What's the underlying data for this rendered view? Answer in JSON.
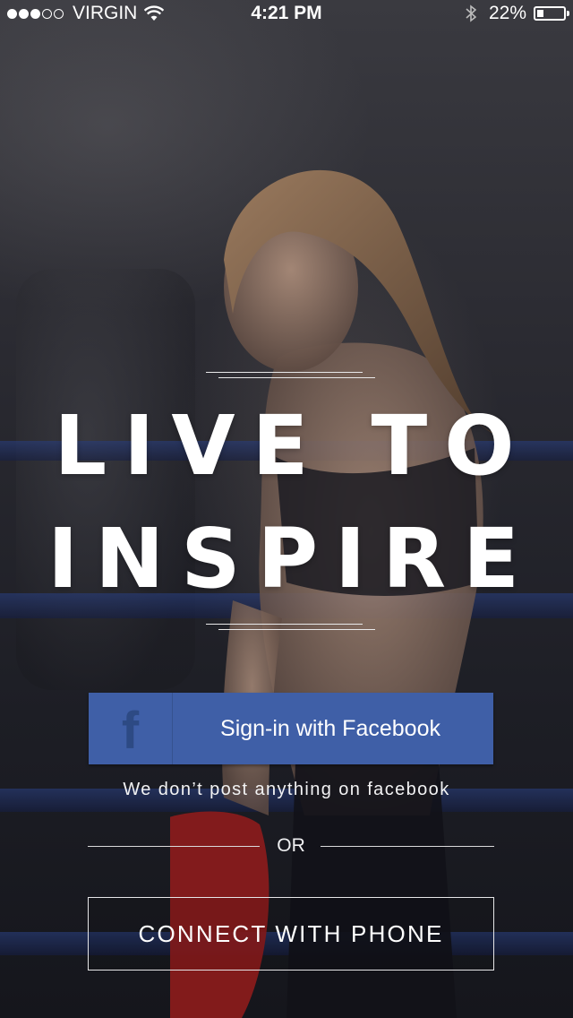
{
  "status_bar": {
    "carrier": "VIRGIN",
    "time": "4:21 PM",
    "battery_percent": "22%",
    "signal_strength": 3,
    "signal_max": 5,
    "battery_level": 0.22
  },
  "hero": {
    "headline_line1": "LIVE TO",
    "headline_line2": "INSPIRE"
  },
  "facebook": {
    "icon": "facebook-f-icon",
    "icon_glyph": "f",
    "label": "Sign-in with Facebook",
    "note": "We don’t post anything on facebook",
    "color": "#3f5fa7"
  },
  "divider": {
    "text": "OR"
  },
  "phone": {
    "label": "CONNECT WITH PHONE"
  },
  "colors": {
    "text": "#ffffff",
    "facebook_blue": "#3f5fa7",
    "background": "#1b1c22"
  }
}
